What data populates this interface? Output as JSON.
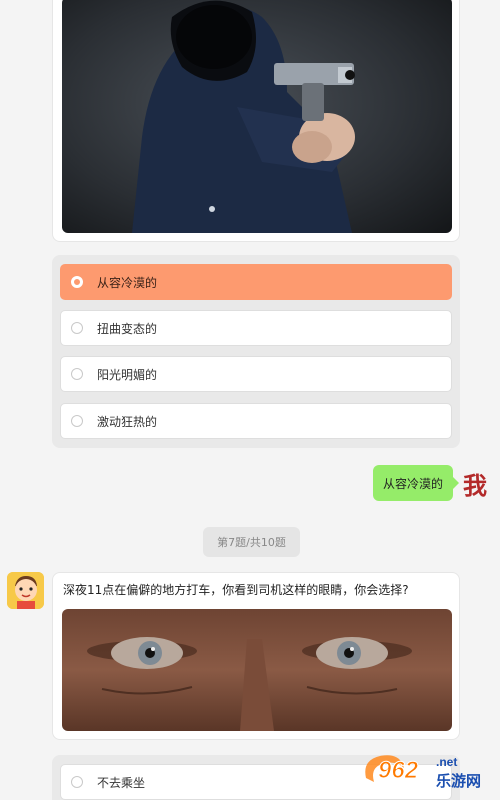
{
  "question_6": {
    "options": [
      {
        "label": "从容冷漠的",
        "selected": true
      },
      {
        "label": "扭曲变态的",
        "selected": false
      },
      {
        "label": "阳光明媚的",
        "selected": false
      },
      {
        "label": "激动狂热的",
        "selected": false
      }
    ]
  },
  "reply": {
    "text": "从容冷漠的",
    "sender_label": "我"
  },
  "progress": {
    "text": "第7题/共10题"
  },
  "question_7": {
    "text": "深夜11点在偏僻的地方打车，你看到司机这样的眼睛，你会选择?",
    "options": [
      {
        "label": "不去乘坐",
        "selected": false
      }
    ]
  },
  "watermark": {
    "number": "962",
    "suffix": ".net",
    "site_name": "乐游网"
  },
  "colors": {
    "selected_option": "#fd9a6f",
    "reply_bubble": "#95ec69",
    "me_label": "#b32a2a"
  }
}
